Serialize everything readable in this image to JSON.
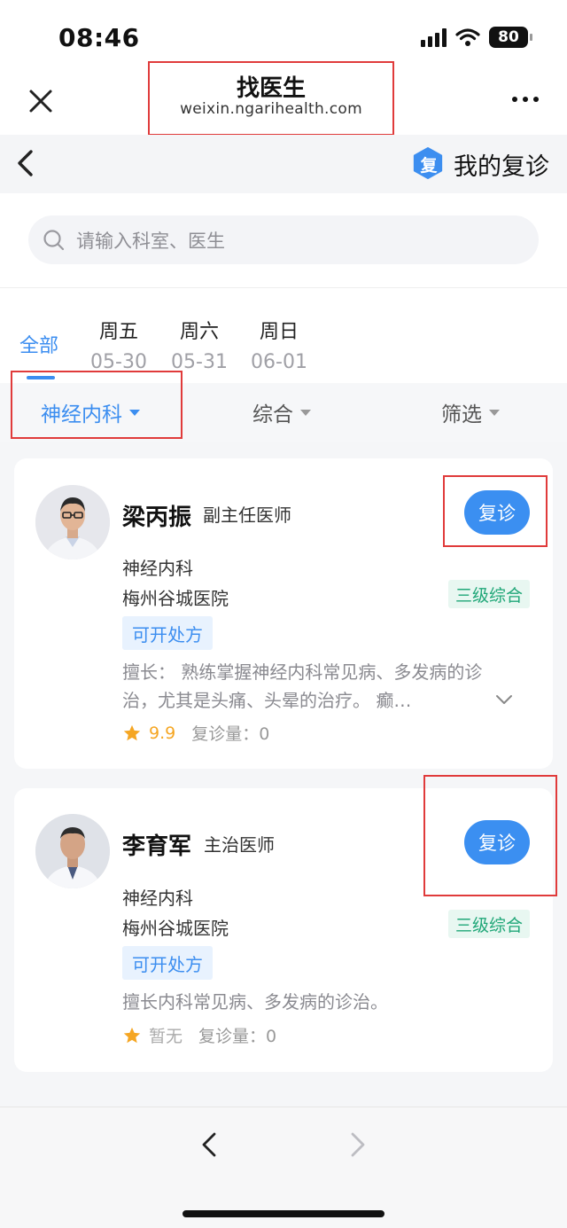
{
  "status_bar": {
    "time": "08:46",
    "battery": "80"
  },
  "navbar": {
    "title": "找医生",
    "subtitle": "weixin.ngarihealth.com"
  },
  "header": {
    "my_revisit_badge": "复",
    "my_revisit_label": "我的复诊"
  },
  "search": {
    "placeholder": "请输入科室、医生"
  },
  "date_tabs": {
    "all_label": "全部",
    "days": [
      {
        "name": "周五",
        "date": "05-30"
      },
      {
        "name": "周六",
        "date": "05-31"
      },
      {
        "name": "周日",
        "date": "06-01"
      }
    ]
  },
  "filters": {
    "department": "神经内科",
    "sort": "综合",
    "screen": "筛选"
  },
  "doctors": [
    {
      "name": "梁丙振",
      "title": "副主任医师",
      "button": "复诊",
      "department": "神经内科",
      "hospital": "梅州谷城医院",
      "hospital_level": "三级综合",
      "tag": "可开处方",
      "specialty": "擅长： 熟练掌握神经内科常见病、多发病的诊治，尤其是头痛、头晕的治疗。 癫…",
      "score": "9.9",
      "revisit_count": "复诊量：0"
    },
    {
      "name": "李育军",
      "title": "主治医师",
      "button": "复诊",
      "department": "神经内科",
      "hospital": "梅州谷城医院",
      "hospital_level": "三级综合",
      "tag": "可开处方",
      "specialty": "擅长内科常见病、多发病的诊治。",
      "score": "暂无",
      "revisit_count": "复诊量：0"
    }
  ],
  "colors": {
    "accent": "#3c8ef0",
    "highlight_box": "#e03b3b",
    "level_green": "#20a778",
    "star": "#f5a623"
  }
}
